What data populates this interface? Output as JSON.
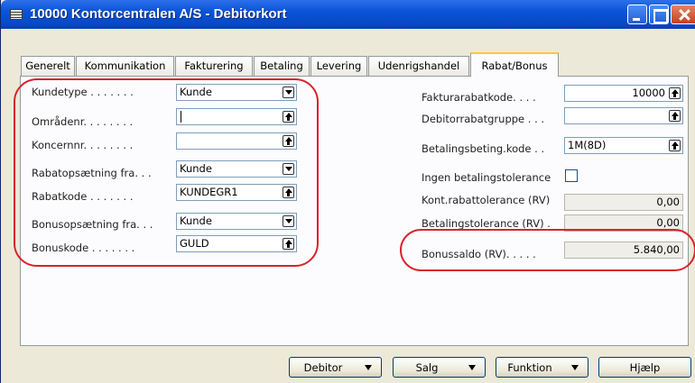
{
  "window": {
    "title": "10000 Kontorcentralen A/S - Debitorkort"
  },
  "tabs": [
    {
      "label": "Generelt"
    },
    {
      "label": "Kommunikation"
    },
    {
      "label": "Fakturering"
    },
    {
      "label": "Betaling"
    },
    {
      "label": "Levering"
    },
    {
      "label": "Udenrigshandel"
    },
    {
      "label": "Rabat/Bonus",
      "active": true
    }
  ],
  "left_fields": [
    {
      "label": "Kundetype . . . . . . .",
      "value": "Kunde",
      "button": "dropdown"
    },
    {
      "label": "Områdenr. . . . . . . .",
      "value": "",
      "button": "lookup"
    },
    {
      "label": "Koncernnr. . . . . . . .",
      "value": "",
      "button": "lookup"
    },
    {
      "label": "Rabatopsætning fra. . .",
      "value": "Kunde",
      "button": "dropdown"
    },
    {
      "label": "Rabatkode . . . . . . .",
      "value": "KUNDEGR1",
      "button": "lookup"
    },
    {
      "label": "Bonusopsætning fra. . .",
      "value": "Kunde",
      "button": "dropdown"
    },
    {
      "label": "Bonuskode . . . . . . .",
      "value": "GULD",
      "button": "lookup"
    }
  ],
  "right_fields": [
    {
      "label": "Fakturarabatkode. . . .",
      "value": "10000",
      "button": "lookup"
    },
    {
      "label": "Debitorrabatgruppe . . .",
      "value": "",
      "button": "lookup"
    },
    {
      "label": "Betalingsbeting.kode . .",
      "value": "1M(8D)",
      "button": "lookup"
    },
    {
      "label": "Ingen betalingstolerance",
      "checked": false
    },
    {
      "label": "Kont.rabattolerance (RV)",
      "value": "0,00"
    },
    {
      "label": "Betalingstolerance (RV) .",
      "value": "0,00"
    },
    {
      "label": "Bonussaldo (RV). . . . .",
      "value": "5.840,00"
    }
  ],
  "buttons": {
    "debitor": "Debitor",
    "salg": "Salg",
    "funktion": "Funktion",
    "hjaelp": "Hjælp"
  },
  "colors": {
    "annotation": "#d9232a",
    "titlebar": "#0a53d8",
    "active_tab_accent": "#ffc83c"
  }
}
